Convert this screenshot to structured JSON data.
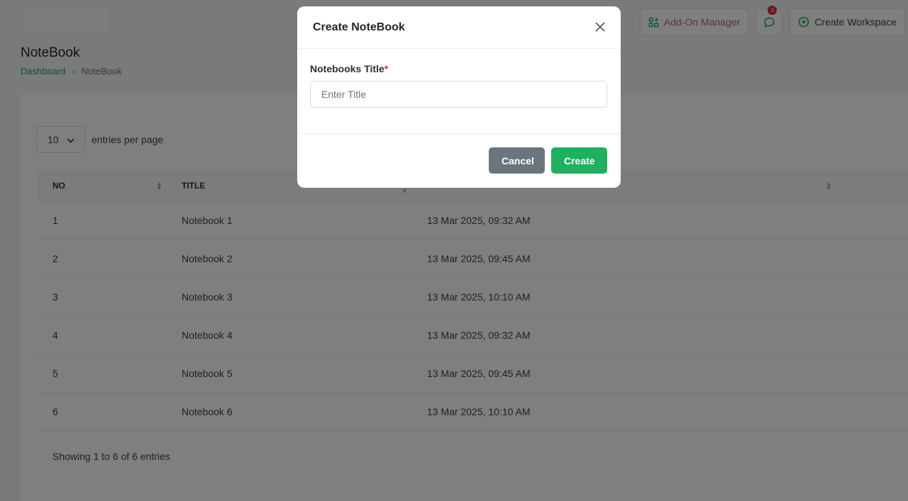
{
  "header": {
    "addon_label": "Add-On Manager",
    "notification_count": "0",
    "create_workspace_label": "Create Workspace"
  },
  "page": {
    "title": "NoteBook",
    "breadcrumb": {
      "home": "Dashboard",
      "separator": "›",
      "current": "NoteBook"
    }
  },
  "table_controls": {
    "entries_value": "10",
    "entries_label": "entries per page"
  },
  "table": {
    "columns": [
      "NO",
      "TITLE",
      ""
    ],
    "rows": [
      {
        "no": "1",
        "title": "Notebook 1",
        "date": "13 Mar 2025, 09:32 AM"
      },
      {
        "no": "2",
        "title": "Notebook 2",
        "date": "13 Mar 2025, 09:45 AM"
      },
      {
        "no": "3",
        "title": "Notebook 3",
        "date": "13 Mar 2025, 10:10 AM"
      },
      {
        "no": "4",
        "title": "Notebook 4",
        "date": "13 Mar 2025, 09:32 AM"
      },
      {
        "no": "5",
        "title": "Notebook 5",
        "date": "13 Mar 2025, 09:45 AM"
      },
      {
        "no": "6",
        "title": "Notebook 6",
        "date": "13 Mar 2025, 10:10 AM"
      }
    ],
    "footer": "Showing 1 to 6 of 6 entries"
  },
  "modal": {
    "title": "Create NoteBook",
    "field_label": "Notebooks Title",
    "required_mark": "*",
    "input_placeholder": "Enter Title",
    "input_value": "",
    "cancel_label": "Cancel",
    "create_label": "Create"
  },
  "colors": {
    "accent": "#1fb15f",
    "secondary": "#6c757d",
    "danger": "#e02847",
    "overlay": "rgba(0,0,0,0.5)"
  },
  "icons": {
    "addon": "grid-plus-icon",
    "chat": "chat-icon",
    "workspace": "plus-circle-icon",
    "close": "close-icon",
    "dropdown": "chevron-down-icon"
  }
}
